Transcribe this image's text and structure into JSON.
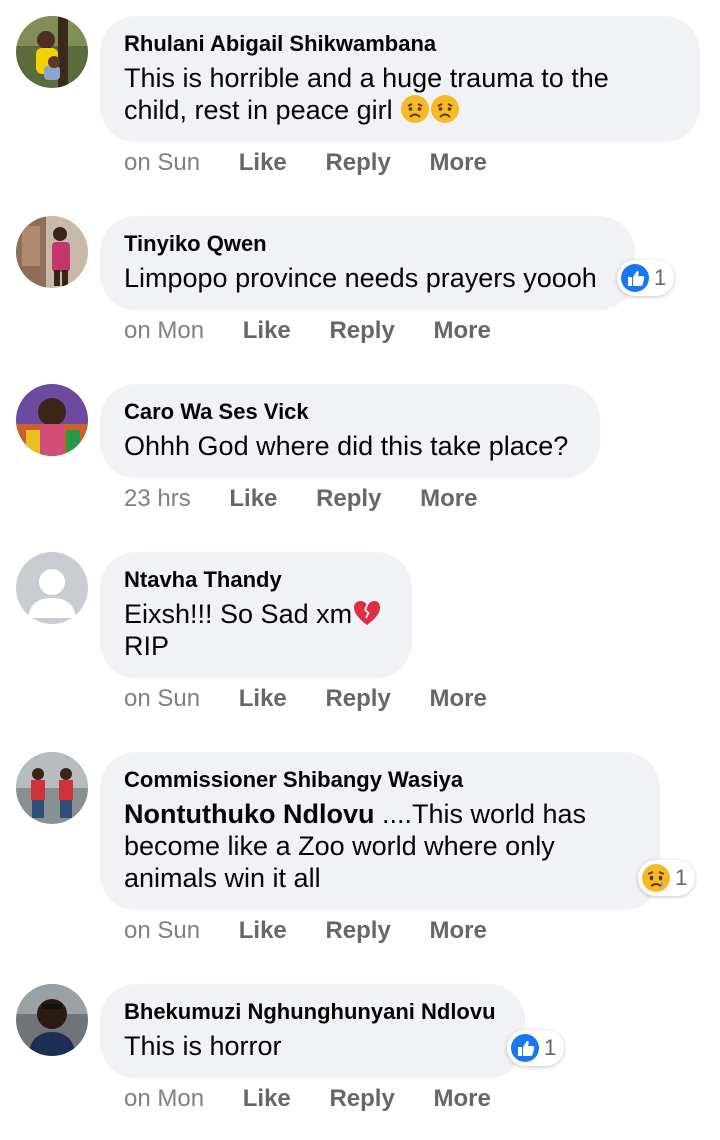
{
  "comments": [
    {
      "author": "Rhulani Abigail Shikwambana",
      "text": "This is horrible and a huge trauma to the child, rest in peace girl",
      "emoji": [
        "sad-face-emoji",
        "sad-face-emoji"
      ],
      "time": "on Sun",
      "like": "Like",
      "reply": "Reply",
      "more": "More"
    },
    {
      "author": "Tinyiko Qwen",
      "text": "Limpopo province needs prayers yoooh",
      "reaction": {
        "icon": "like-icon",
        "count": "1"
      },
      "time": "on Mon",
      "like": "Like",
      "reply": "Reply",
      "more": "More"
    },
    {
      "author": "Caro Wa Ses Vick",
      "text": "Ohhh God where did this take place?",
      "time": "23 hrs",
      "like": "Like",
      "reply": "Reply",
      "more": "More"
    },
    {
      "author": "Ntavha Thandy",
      "text": "Eixsh!!! So Sad xm",
      "text2": "RIP",
      "emoji": [
        "broken-heart-emoji"
      ],
      "time": "on Sun",
      "like": "Like",
      "reply": "Reply",
      "more": "More"
    },
    {
      "author": "Commissioner Shibangy Wasiya",
      "mention": "Nontuthuko Ndlovu",
      "text": "....This world has become like a Zoo world where only animals win it all",
      "reaction": {
        "icon": "sad-reaction-icon",
        "count": "1"
      },
      "time": "on Sun",
      "like": "Like",
      "reply": "Reply",
      "more": "More"
    },
    {
      "author": "Bhekumuzi Nghunghunyani Ndlovu",
      "text": "This is horror",
      "reaction": {
        "icon": "like-icon",
        "count": "1"
      },
      "time": "on Mon",
      "like": "Like",
      "reply": "Reply",
      "more": "More"
    }
  ],
  "colors": {
    "bubble": "#f0f2f5",
    "secondary_text": "#65676b",
    "like_blue": "#1877f2",
    "reaction_yellow": "#f7b928"
  }
}
